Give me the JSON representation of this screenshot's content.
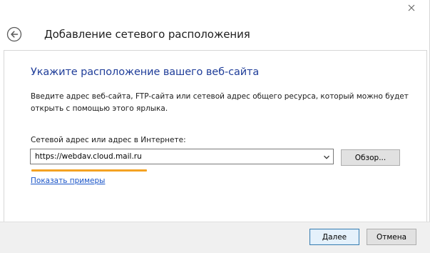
{
  "window": {
    "close_icon": "close-icon"
  },
  "header": {
    "title": "Добавление сетевого расположения",
    "back_icon": "back-arrow-icon"
  },
  "content": {
    "section_title": "Укажите расположение вашего веб-сайта",
    "description": "Введите адрес веб-сайта, FTP-сайта или сетевой адрес общего ресурса, который можно будет открыть с помощью этого ярлыка.",
    "field_label": "Сетевой адрес или адрес в Интернете:",
    "address_value": "https://webdav.cloud.mail.ru",
    "browse_label": "Обзор...",
    "examples_link": "Показать примеры",
    "highlight_color": "#f4a222",
    "title_color": "#1f3d99",
    "link_color": "#1a55c8"
  },
  "footer": {
    "next_label": "Далее",
    "cancel_label": "Отмена"
  }
}
